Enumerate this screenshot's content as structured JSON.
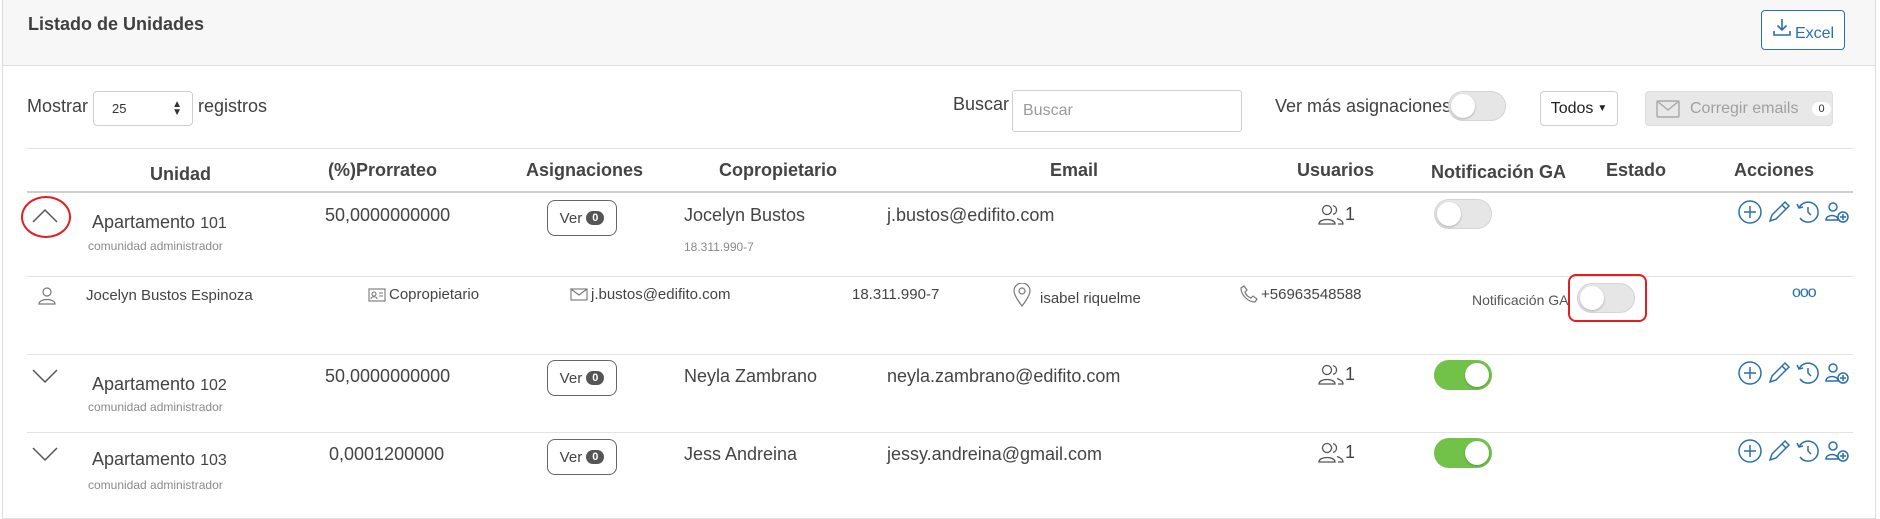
{
  "header": {
    "title": "Listado de Unidades",
    "excel_label": "Excel"
  },
  "controls": {
    "show_label": "Mostrar",
    "page_size": "25",
    "records_label": "registros",
    "search_label": "Buscar",
    "search_placeholder": "Buscar",
    "more_assign_label": "Ver más asignaciones",
    "filter_label": "Todos",
    "fix_emails_label": "Corregir emails",
    "fix_emails_count": "0"
  },
  "table": {
    "columns": [
      "Unidad",
      "(%)Prorrateo",
      "Asignaciones",
      "Copropietario",
      "Email",
      "Usuarios",
      "Notificación GA",
      "Estado",
      "Acciones"
    ],
    "rows": [
      {
        "unit_name": "Apartamento",
        "unit_number": "101",
        "unit_sub": "comunidad administrador",
        "prorrateo": "50,0000000000",
        "ver_label": "Ver",
        "ver_count": "0",
        "owner": "Jocelyn Bustos",
        "owner_id": "18.311.990-7",
        "email": "j.bustos@edifito.com",
        "users": "1",
        "notif_on": false,
        "expanded": true
      },
      {
        "unit_name": "Apartamento",
        "unit_number": "102",
        "unit_sub": "comunidad administrador",
        "prorrateo": "50,0000000000",
        "ver_label": "Ver",
        "ver_count": "0",
        "owner": "Neyla Zambrano",
        "email": "neyla.zambrano@edifito.com",
        "users": "1",
        "notif_on": true,
        "expanded": false
      },
      {
        "unit_name": "Apartamento",
        "unit_number": "103",
        "unit_sub": "comunidad administrador",
        "prorrateo": "0,0001200000",
        "ver_label": "Ver",
        "ver_count": "0",
        "owner": "Jess Andreina",
        "email": "jessy.andreina@gmail.com",
        "users": "1",
        "notif_on": true,
        "expanded": false
      }
    ],
    "detail": {
      "name": "Jocelyn Bustos Espinoza",
      "role": "Copropietario",
      "email": "j.bustos@edifito.com",
      "rut": "18.311.990-7",
      "location": "isabel riquelme",
      "phone": "+56963548588",
      "notif_label": "Notificación GA",
      "notif_on": false,
      "more_label": "ooo"
    }
  },
  "colors": {
    "accent": "#2a6fb0",
    "toggle_on": "#72c24a",
    "highlight": "#e02020"
  }
}
